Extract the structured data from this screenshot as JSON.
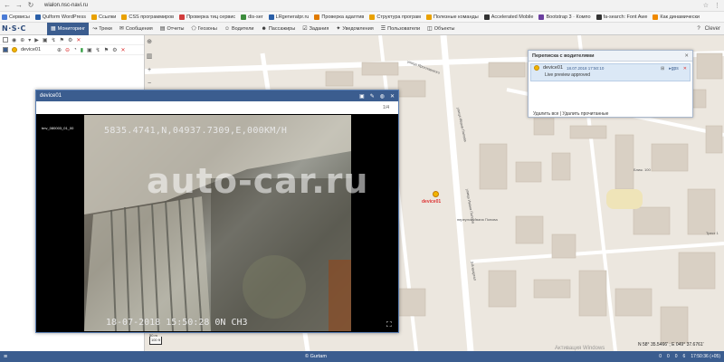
{
  "browser": {
    "url": "wialon.nsc-navi.ru",
    "bookmarks": [
      {
        "label": "Сервисы",
        "color": "#4a7bd6"
      },
      {
        "label": "Qulform WordPress",
        "color": "#2a5fa8"
      },
      {
        "label": "Ссылки",
        "color": "#e9a100"
      },
      {
        "label": "CSS программиров",
        "color": "#e9a100"
      },
      {
        "label": "Проверка тиц сервис",
        "color": "#d23c3c"
      },
      {
        "label": "dis-ser",
        "color": "#3c8c3c"
      },
      {
        "label": "LRgeneratpr.ru",
        "color": "#2a5fa8"
      },
      {
        "label": "Проверка адаптив",
        "color": "#e07a00"
      },
      {
        "label": "Структура програм",
        "color": "#e9a100"
      },
      {
        "label": "Полезные команды",
        "color": "#e9a100"
      },
      {
        "label": "Accelerated Mobile",
        "color": "#333333"
      },
      {
        "label": "Bootstrap 3 · Компо",
        "color": "#6b3fa0"
      },
      {
        "label": "fa-search: Font Awe",
        "color": "#333333"
      },
      {
        "label": "Как динамически",
        "color": "#f08a00"
      }
    ]
  },
  "app": {
    "logo": "N·S·C",
    "nav": [
      {
        "label": "Мониторинг",
        "icon": "monitor-icon",
        "active": true
      },
      {
        "label": "Треки",
        "icon": "track-icon"
      },
      {
        "label": "Сообщения",
        "icon": "message-icon"
      },
      {
        "label": "Отчеты",
        "icon": "report-icon"
      },
      {
        "label": "Геозоны",
        "icon": "geozone-icon"
      },
      {
        "label": "Водители",
        "icon": "driver-icon"
      },
      {
        "label": "Пассажиры",
        "icon": "passenger-icon"
      },
      {
        "label": "Задания",
        "icon": "task-icon"
      },
      {
        "label": "Уведомления",
        "icon": "bell-icon"
      },
      {
        "label": "Пользователи",
        "icon": "users-icon"
      },
      {
        "label": "Объекты",
        "icon": "car-icon"
      }
    ],
    "user": "Clever"
  },
  "unit_list": {
    "rows": [
      {
        "name": "device01"
      }
    ]
  },
  "video": {
    "title": "device01",
    "sub": "1/4",
    "cam_label": "tmv_080003_01_00",
    "gps_overlay": "5835.4741,N,04937.7309,E,000KM/H",
    "timestamp_overlay": "18-07-2018 15:50:28 0N CH3",
    "watermark": "auto-car.ru"
  },
  "chat": {
    "title": "Переписка с водителями",
    "message": {
      "device": "device01",
      "time": "18.07.2018 17:50:10",
      "text": "Live preview approved",
      "tag": "gps"
    },
    "actions": "Удалить все | Удалить прочитанные"
  },
  "map": {
    "marker_label": "device01",
    "street_labels": [
      "улица Ярославского",
      "улица Ивана Попова",
      "улица Ивана Попова",
      "переулок Ивана Попова",
      "3-й квартал",
      "Ближ. 100",
      "Трест 1"
    ],
    "scale_top": "50 m",
    "scale_bottom": "100 ft",
    "coords": "N 58° 35.5466' ; E 049° 37.6761'",
    "activate": "Активация Windows"
  },
  "footer": {
    "copyright": "© Gurtam",
    "time": "17:50:36 (+05)",
    "counters": [
      "6",
      "0",
      "0",
      "0"
    ]
  }
}
